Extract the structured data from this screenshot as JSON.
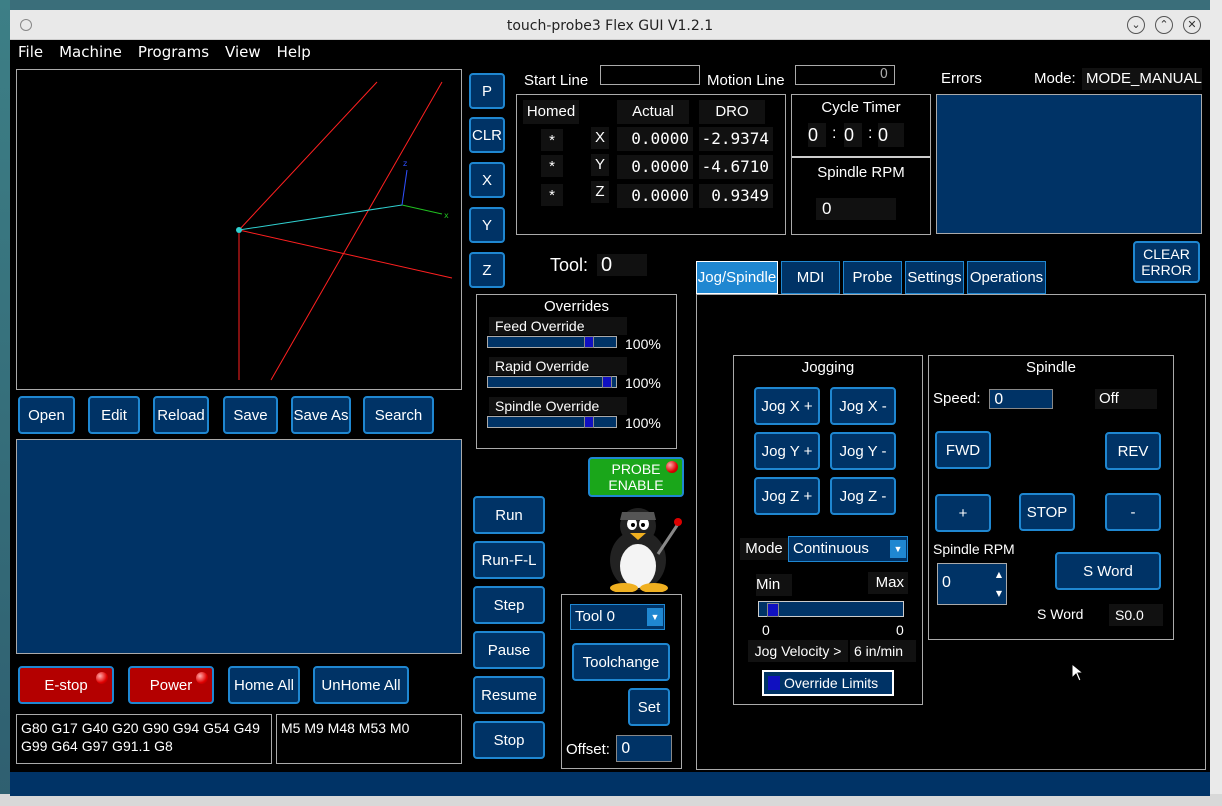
{
  "window": {
    "title": "touch-probe3 Flex GUI V1.2.1"
  },
  "menu": [
    "File",
    "Machine",
    "Programs",
    "View",
    "Help"
  ],
  "view_buttons": [
    "P",
    "CLR",
    "X",
    "Y",
    "Z"
  ],
  "file_buttons": [
    "Open",
    "Edit",
    "Reload",
    "Save",
    "Save As",
    "Search"
  ],
  "machine_buttons": {
    "estop": "E-stop",
    "power": "Power",
    "home_all": "Home All",
    "unhome_all": "UnHome All"
  },
  "gcodes": "G80 G17 G40 G20 G90 G94 G54 G49 G99 G64 G97 G91.1 G8",
  "mcodes": "M5 M9 M48 M53 M0",
  "start_line": {
    "label": "Start Line",
    "value": ""
  },
  "motion_line": {
    "label": "Motion Line",
    "value": "0"
  },
  "dro": {
    "headers": {
      "homed": "Homed",
      "actual": "Actual",
      "dro": "DRO"
    },
    "rows": [
      {
        "homed": "*",
        "axis": "X",
        "actual": "0.0000",
        "dro": "-2.9374"
      },
      {
        "homed": "*",
        "axis": "Y",
        "actual": "0.0000",
        "dro": "-4.6710"
      },
      {
        "homed": "*",
        "axis": "Z",
        "actual": "0.0000",
        "dro": "0.9349"
      }
    ]
  },
  "cycle_timer": {
    "label": "Cycle Timer",
    "h": "0",
    "m": "0",
    "s": "0",
    "sep": ":"
  },
  "spindle_rpm_display": {
    "label": "Spindle RPM",
    "value": "0"
  },
  "errors": {
    "label": "Errors",
    "clear": "CLEAR ERROR"
  },
  "mode": {
    "label": "Mode:",
    "value": "MODE_MANUAL"
  },
  "tool": {
    "label": "Tool:",
    "value": "0"
  },
  "overrides": {
    "title": "Overrides",
    "items": [
      {
        "label": "Feed Override",
        "value": "100%",
        "level": 0.8
      },
      {
        "label": "Rapid Override",
        "value": "100%",
        "level": 0.95
      },
      {
        "label": "Spindle Override",
        "value": "100%",
        "level": 0.8
      }
    ]
  },
  "probe_enable": "PROBE ENABLE",
  "run_buttons": [
    "Run",
    "Run-F-L",
    "Step",
    "Pause",
    "Resume",
    "Stop"
  ],
  "toolchange": {
    "tool_select": "Tool 0",
    "toolchange": "Toolchange",
    "set": "Set",
    "offset_label": "Offset:",
    "offset_value": "0"
  },
  "tabs": [
    "Jog/Spindle",
    "MDI",
    "Probe",
    "Settings",
    "Operations"
  ],
  "active_tab": 0,
  "jogging": {
    "title": "Jogging",
    "buttons": [
      "Jog X +",
      "Jog X -",
      "Jog Y +",
      "Jog Y -",
      "Jog Z +",
      "Jog Z -"
    ],
    "mode_label": "Mode",
    "mode_value": "Continuous",
    "min_label": "Min",
    "max_label": "Max",
    "min_value": "0",
    "max_value": "0",
    "velocity_label": "Jog Velocity >",
    "velocity_value": "6 in/min",
    "override_limits": "Override Limits"
  },
  "spindle": {
    "title": "Spindle",
    "speed_label": "Speed:",
    "speed_value": "0",
    "state": "Off",
    "fwd": "FWD",
    "rev": "REV",
    "plus": "+",
    "stop": "STOP",
    "minus": "-",
    "rpm_label": "Spindle RPM",
    "rpm_value": "0",
    "s_word_button": "S Word",
    "s_word_label": "S Word",
    "s_word_value": "S0.0"
  },
  "colors": {
    "panel_blue": "#003366",
    "accent": "#1f87d1",
    "estop_red": "#b40000",
    "probe_green": "#1aa61a"
  },
  "icons": [
    "tux-mascot-icon",
    "led-red-icon",
    "dropdown-arrow-icon"
  ]
}
